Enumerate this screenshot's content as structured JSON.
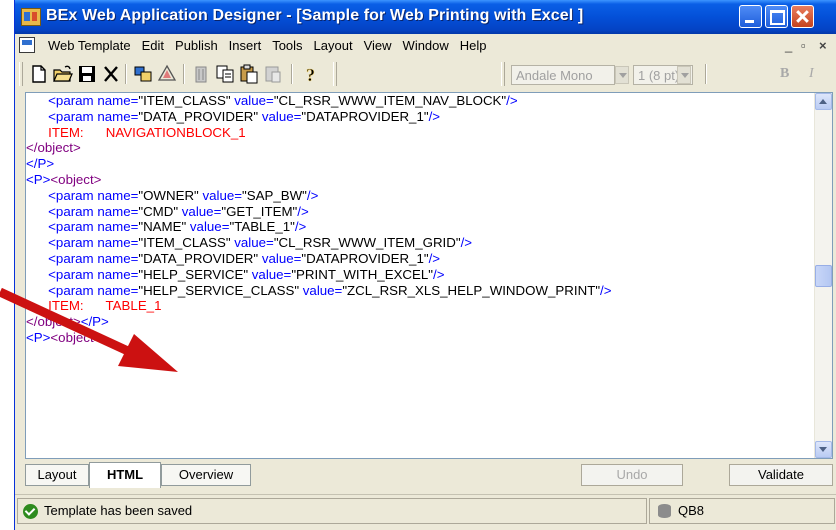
{
  "window": {
    "title": "BEx Web Application Designer - [Sample for Web Printing with Excel ]"
  },
  "menubar": {
    "items": [
      "Web Template",
      "Edit",
      "Publish",
      "Insert",
      "Tools",
      "Layout",
      "View",
      "Window",
      "Help"
    ],
    "mdi_min": "_",
    "mdi_restore": "▫",
    "mdi_close": "×"
  },
  "toolbar": {
    "icons": [
      "new-icon",
      "open-icon",
      "save-icon",
      "delete-icon",
      "item-icon",
      "wizard-icon",
      "trash-icon",
      "copy-icon",
      "paste-icon",
      "paste-special-icon",
      "help-icon"
    ],
    "font": "Andale Mono",
    "font_size": "1 (8 pt)",
    "bold": "B",
    "italic": "I"
  },
  "editor": {
    "lines": [
      [
        {
          "t": "      ",
          "c": "black"
        },
        {
          "t": "<param name=",
          "c": "blue"
        },
        {
          "t": "\"ITEM_CLASS\"",
          "c": "black"
        },
        {
          "t": " value=",
          "c": "blue"
        },
        {
          "t": "\"CL_RSR_WWW_ITEM_NAV_BLOCK\"",
          "c": "black"
        },
        {
          "t": "/>",
          "c": "blue"
        }
      ],
      [
        {
          "t": "      ",
          "c": "black"
        },
        {
          "t": "<param name=",
          "c": "blue"
        },
        {
          "t": "\"DATA_PROVIDER\"",
          "c": "black"
        },
        {
          "t": " value=",
          "c": "blue"
        },
        {
          "t": "\"DATAPROVIDER_1\"",
          "c": "black"
        },
        {
          "t": "/>",
          "c": "blue"
        }
      ],
      [
        {
          "t": "      ITEM:      NAVIGATIONBLOCK_1",
          "c": "red"
        }
      ],
      [
        {
          "t": "</object>",
          "c": "purple"
        }
      ],
      [
        {
          "t": "</P>",
          "c": "blue"
        }
      ],
      [
        {
          "t": "<P>",
          "c": "blue"
        },
        {
          "t": "<object>",
          "c": "purple"
        }
      ],
      [
        {
          "t": "      ",
          "c": "black"
        },
        {
          "t": "<param name=",
          "c": "blue"
        },
        {
          "t": "\"OWNER\"",
          "c": "black"
        },
        {
          "t": " value=",
          "c": "blue"
        },
        {
          "t": "\"SAP_BW\"",
          "c": "black"
        },
        {
          "t": "/>",
          "c": "blue"
        }
      ],
      [
        {
          "t": "      ",
          "c": "black"
        },
        {
          "t": "<param name=",
          "c": "blue"
        },
        {
          "t": "\"CMD\"",
          "c": "black"
        },
        {
          "t": " value=",
          "c": "blue"
        },
        {
          "t": "\"GET_ITEM\"",
          "c": "black"
        },
        {
          "t": "/>",
          "c": "blue"
        }
      ],
      [
        {
          "t": "      ",
          "c": "black"
        },
        {
          "t": "<param name=",
          "c": "blue"
        },
        {
          "t": "\"NAME\"",
          "c": "black"
        },
        {
          "t": " value=",
          "c": "blue"
        },
        {
          "t": "\"TABLE_1\"",
          "c": "black"
        },
        {
          "t": "/>",
          "c": "blue"
        }
      ],
      [
        {
          "t": "      ",
          "c": "black"
        },
        {
          "t": "<param name=",
          "c": "blue"
        },
        {
          "t": "\"ITEM_CLASS\"",
          "c": "black"
        },
        {
          "t": " value=",
          "c": "blue"
        },
        {
          "t": "\"CL_RSR_WWW_ITEM_GRID\"",
          "c": "black"
        },
        {
          "t": "/>",
          "c": "blue"
        }
      ],
      [
        {
          "t": "      ",
          "c": "black"
        },
        {
          "t": "<param name=",
          "c": "blue"
        },
        {
          "t": "\"DATA_PROVIDER\"",
          "c": "black"
        },
        {
          "t": " value=",
          "c": "blue"
        },
        {
          "t": "\"DATAPROVIDER_1\"",
          "c": "black"
        },
        {
          "t": "/>",
          "c": "blue"
        }
      ],
      [
        {
          "t": "      ",
          "c": "black"
        },
        {
          "t": "<param name=",
          "c": "blue"
        },
        {
          "t": "\"HELP_SERVICE\"",
          "c": "black"
        },
        {
          "t": " value=",
          "c": "blue"
        },
        {
          "t": "\"PRINT_WITH_EXCEL\"",
          "c": "black"
        },
        {
          "t": "/>",
          "c": "blue"
        }
      ],
      [
        {
          "t": "      ",
          "c": "black"
        },
        {
          "t": "<param name=",
          "c": "blue"
        },
        {
          "t": "\"HELP_SERVICE_CLASS\"",
          "c": "black"
        },
        {
          "t": " value=",
          "c": "blue"
        },
        {
          "t": "\"ZCL_RSR_XLS_HELP_WINDOW_PRINT\"",
          "c": "black"
        },
        {
          "t": "/>",
          "c": "blue"
        }
      ],
      [
        {
          "t": "      ITEM:      TABLE_1",
          "c": "red"
        }
      ],
      [
        {
          "t": "</object>",
          "c": "purple"
        },
        {
          "t": "</P>",
          "c": "blue"
        }
      ],
      [
        {
          "t": "<P>",
          "c": "blue"
        },
        {
          "t": "<object>",
          "c": "purple"
        }
      ]
    ]
  },
  "tabs": [
    {
      "label": "Layout",
      "active": false
    },
    {
      "label": "HTML",
      "active": true
    },
    {
      "label": "Overview",
      "active": false
    }
  ],
  "buttons": {
    "undo": "Undo",
    "validate": "Validate"
  },
  "status": {
    "message": "Template has been saved",
    "system": "QB8"
  },
  "colors": {
    "titlebar": "#0450d8",
    "annotation_arrow": "#cc1111"
  }
}
